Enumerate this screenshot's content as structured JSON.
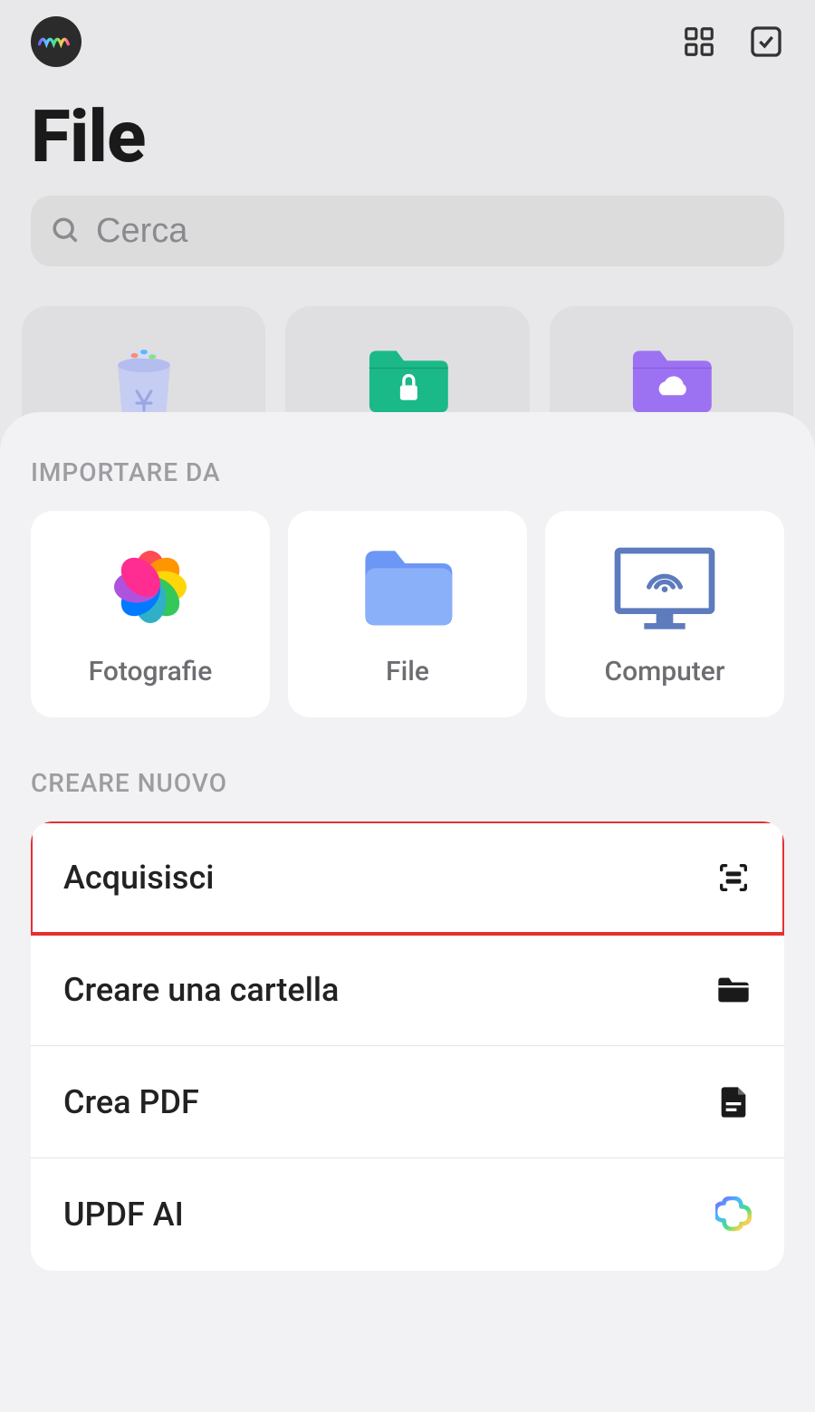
{
  "header": {
    "title": "File"
  },
  "search": {
    "placeholder": "Cerca"
  },
  "sheet": {
    "import_section_label": "Importare da",
    "import_options": {
      "photos": "Fotografie",
      "file": "File",
      "computer": "Computer"
    },
    "create_section_label": "Creare nuovo",
    "create_rows": {
      "scan": "Acquisisci",
      "folder": "Creare una cartella",
      "pdf": "Crea PDF",
      "ai": "UPDF AI"
    }
  }
}
